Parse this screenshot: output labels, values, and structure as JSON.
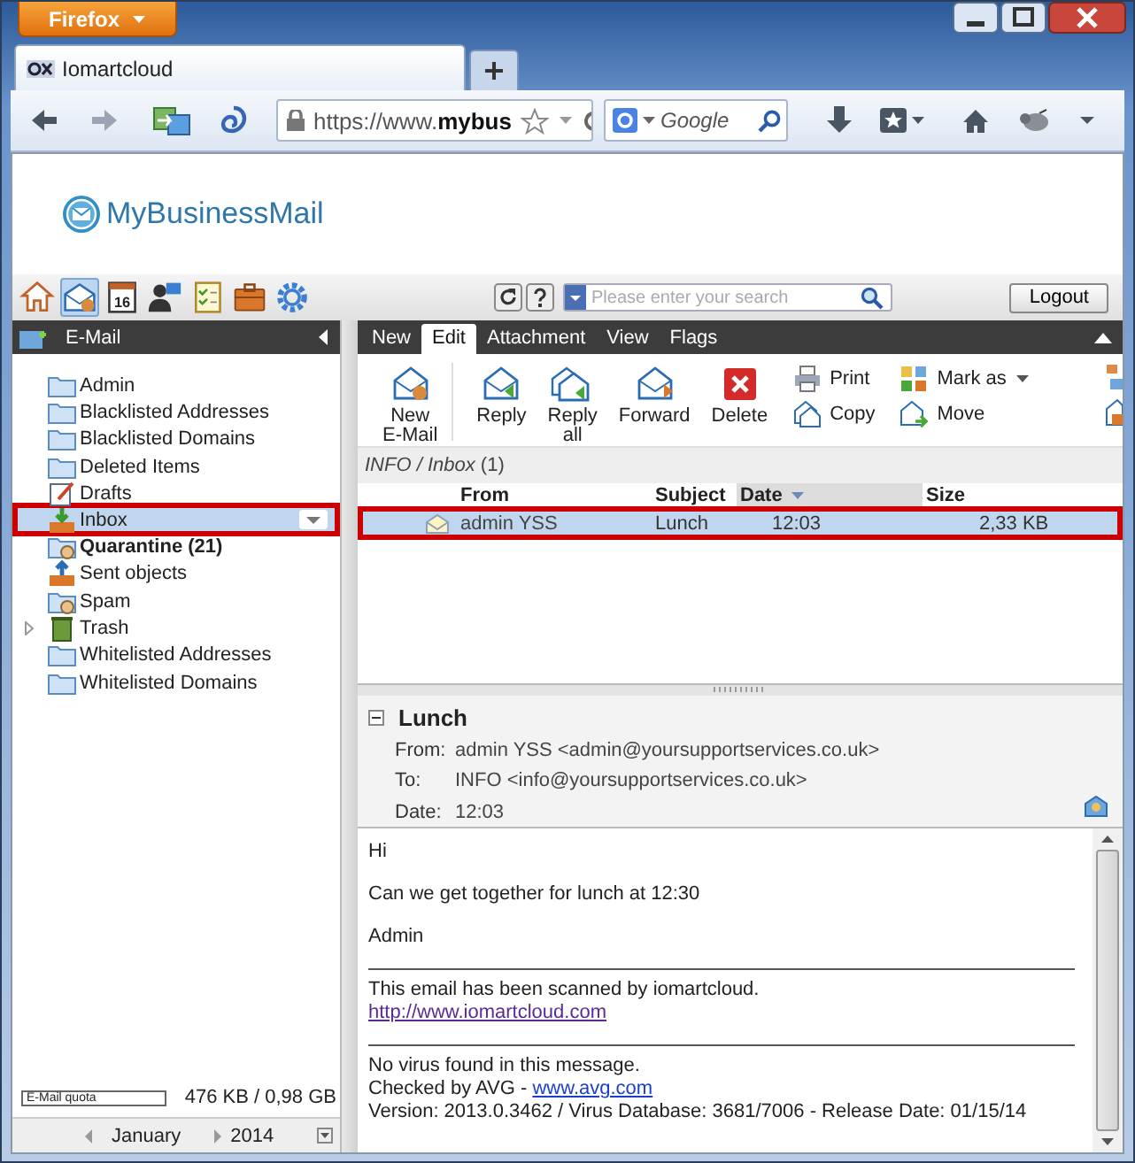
{
  "browser": {
    "menu_button": "Firefox",
    "tabs": [
      {
        "title": "Iomartcloud",
        "selected": true
      }
    ],
    "address": "https://www.**mybus**",
    "search": {
      "placeholder": "Google"
    }
  },
  "app": {
    "logo": "MyBusinessMail",
    "modules": [
      {
        "kind": "home",
        "selected": false
      },
      {
        "kind": "mail",
        "selected": true
      },
      {
        "kind": "calendar",
        "label": "16",
        "selected": false
      },
      {
        "kind": "contacts",
        "selected": false
      },
      {
        "kind": "tasks",
        "selected": false
      },
      {
        "kind": "files",
        "selected": false
      },
      {
        "kind": "settings",
        "selected": false
      }
    ],
    "search": {
      "placeholder": "Please enter your search"
    },
    "logout": "Logout"
  },
  "sidebar": {
    "title": "E-Mail",
    "folders": [
      {
        "name": "Admin",
        "kind": "folder",
        "selected": false,
        "marked": false,
        "unread": false,
        "expandable": false
      },
      {
        "name": "Blacklisted Addresses",
        "kind": "folder",
        "selected": false,
        "marked": false,
        "unread": false,
        "expandable": false
      },
      {
        "name": "Blacklisted Domains",
        "kind": "folder",
        "selected": false,
        "marked": false,
        "unread": false,
        "expandable": false
      },
      {
        "name": "Deleted Items",
        "kind": "folder",
        "selected": false,
        "marked": false,
        "unread": false,
        "expandable": false
      },
      {
        "name": "Drafts",
        "kind": "drafts",
        "selected": false,
        "marked": false,
        "unread": false,
        "expandable": false
      },
      {
        "name": "Inbox",
        "kind": "inbox",
        "selected": true,
        "marked": true,
        "unread": false,
        "expandable": false
      },
      {
        "name": "Quarantine (21)",
        "kind": "quarantine",
        "selected": false,
        "marked": false,
        "unread": true,
        "expandable": false
      },
      {
        "name": "Sent objects",
        "kind": "sent",
        "selected": false,
        "marked": false,
        "unread": false,
        "expandable": false
      },
      {
        "name": "Spam",
        "kind": "quarantine",
        "selected": false,
        "marked": false,
        "unread": false,
        "expandable": false
      },
      {
        "name": "Trash",
        "kind": "trash",
        "selected": false,
        "marked": false,
        "unread": false,
        "expandable": true
      },
      {
        "name": "Whitelisted Addresses",
        "kind": "folder",
        "selected": false,
        "marked": false,
        "unread": false,
        "expandable": false
      },
      {
        "name": "Whitelisted Domains",
        "kind": "folder",
        "selected": false,
        "marked": false,
        "unread": false,
        "expandable": false
      }
    ],
    "quota": {
      "label": "E-Mail quota",
      "level": 0.0005,
      "reading": "476 KB / 0,98 GB"
    },
    "calendar": {
      "month": "January",
      "year": "2014"
    }
  },
  "ribbon": {
    "tabs": [
      {
        "label": "New",
        "selected": false
      },
      {
        "label": "Edit",
        "selected": true
      },
      {
        "label": "Attachment",
        "selected": false
      },
      {
        "label": "View",
        "selected": false
      },
      {
        "label": "Flags",
        "selected": false
      }
    ],
    "large_buttons": [
      {
        "label": "New E-Mail",
        "kind": "new"
      },
      {
        "label": "Reply",
        "kind": "reply"
      },
      {
        "label": "Reply all",
        "kind": "replyall"
      },
      {
        "label": "Forward",
        "kind": "forward"
      },
      {
        "label": "Delete",
        "kind": "delete"
      }
    ],
    "small_buttons": [
      {
        "label": "Print",
        "kind": "print",
        "dropdown": false
      },
      {
        "label": "Mark as",
        "kind": "mark",
        "dropdown": true
      },
      {
        "label": "Copy",
        "kind": "copy",
        "dropdown": false
      },
      {
        "label": "Move",
        "kind": "move",
        "dropdown": false
      }
    ]
  },
  "breadcrumb": "*INFO / Inbox* (1)",
  "table": {
    "columns": [
      {
        "label": "From",
        "sorted": false
      },
      {
        "label": "Subject",
        "sorted": false
      },
      {
        "label": "Date",
        "sorted": true
      },
      {
        "label": "Size",
        "sorted": false
      }
    ],
    "rows": [
      {
        "from": "admin YSS",
        "subject": "Lunch",
        "date": "12:03",
        "size": "2,33 KB",
        "selected": true,
        "marked": true
      }
    ]
  },
  "preview": {
    "subject": "Lunch",
    "fields": [
      {
        "label": "From:",
        "value": "admin YSS <admin@yoursupportservices.co.uk>"
      },
      {
        "label": "To:",
        "value": "INFO <info@yoursupportservices.co.uk>"
      },
      {
        "label": "Date:",
        "value": "12:03"
      }
    ],
    "body": [
      {
        "kind": "paragraph",
        "lines": [
          {
            "text": "Hi"
          }
        ]
      },
      {
        "kind": "paragraph",
        "lines": [
          {
            "text": "Can we get together for lunch at 12:30"
          }
        ]
      },
      {
        "kind": "paragraph",
        "lines": [
          {
            "text": "Admin"
          }
        ]
      },
      {
        "kind": "rule"
      },
      {
        "kind": "paragraph",
        "lines": [
          {
            "text": "This email has been scanned by iomartcloud."
          },
          {
            "link": "http://www.iomartcloud.com",
            "visited": true
          }
        ]
      },
      {
        "kind": "rule"
      },
      {
        "kind": "paragraph",
        "lines": [
          {
            "text": "No virus found in this message."
          },
          {
            "text": "Checked by AVG -",
            "link": "www.avg.com",
            "visited": false
          },
          {
            "text": "Version: 2013.0.3462 / Virus Database: 3681/7006 - Release Date: 01/15/14"
          }
        ]
      }
    ]
  }
}
